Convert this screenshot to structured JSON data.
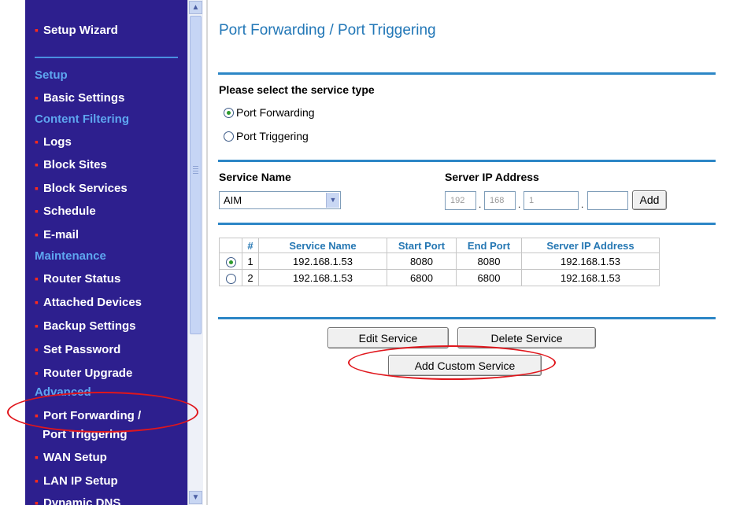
{
  "sidebar": {
    "setup_wizard": "Setup Wizard",
    "setup_heading": "Setup",
    "basic_settings": "Basic Settings",
    "content_filtering_heading": "Content Filtering",
    "logs": "Logs",
    "block_sites": "Block Sites",
    "block_services": "Block Services",
    "schedule": "Schedule",
    "email": "E-mail",
    "maintenance_heading": "Maintenance",
    "router_status": "Router Status",
    "attached_devices": "Attached Devices",
    "backup_settings": "Backup Settings",
    "set_password": "Set Password",
    "router_upgrade": "Router Upgrade",
    "advanced_heading": "Advanced",
    "port_forwarding_line1": "Port Forwarding /",
    "port_forwarding_line2": "Port Triggering",
    "wan_setup": "WAN Setup",
    "lan_ip_setup": "LAN IP Setup",
    "dynamic_dns": "Dynamic DNS"
  },
  "main": {
    "title": "Port Forwarding / Port Triggering",
    "service_type_label": "Please select the service type",
    "option_port_forwarding": "Port Forwarding",
    "option_port_triggering": "Port Triggering",
    "selected_option": "Port Forwarding",
    "service_name_label": "Service Name",
    "service_name_value": "AIM",
    "server_ip_label": "Server IP Address",
    "ip_octets": [
      "192",
      "168",
      "1",
      ""
    ],
    "add_button": "Add",
    "table": {
      "headers": [
        "",
        "#",
        "Service Name",
        "Start Port",
        "End Port",
        "Server IP Address"
      ],
      "rows": [
        {
          "selected": true,
          "num": "1",
          "service_name": "192.168.1.53",
          "start_port": "8080",
          "end_port": "8080",
          "server_ip": "192.168.1.53"
        },
        {
          "selected": false,
          "num": "2",
          "service_name": "192.168.1.53",
          "start_port": "6800",
          "end_port": "6800",
          "server_ip": "192.168.1.53"
        }
      ]
    },
    "edit_service_button": "Edit Service",
    "delete_service_button": "Delete Service",
    "add_custom_service_button": "Add Custom Service"
  },
  "colors": {
    "sidebar_bg": "#2d1f8e",
    "heading_blue": "#2277b7",
    "annotation_red": "#e0161c"
  }
}
